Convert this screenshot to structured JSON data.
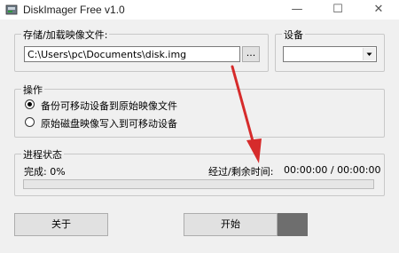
{
  "window": {
    "title": "DiskImager Free v1.0",
    "minimize_glyph": "—",
    "maximize_glyph": "☐",
    "close_glyph": "✕"
  },
  "storage": {
    "label": "存储/加载映像文件:",
    "path": "C:\\Users\\pc\\Documents\\disk.img",
    "browse_label": "..."
  },
  "device": {
    "label": "设备",
    "selected": ""
  },
  "operation": {
    "label": "操作",
    "options": [
      {
        "label": "备份可移动设备到原始映像文件",
        "checked": true
      },
      {
        "label": "原始磁盘映像写入到可移动设备",
        "checked": false
      }
    ]
  },
  "progress": {
    "label": "进程状态",
    "completed_label": "完成: 0%",
    "time_label": "经过/剩余时间:",
    "time_value": "00:00:00 / 00:00:00",
    "value": 0
  },
  "buttons": {
    "about": "关于",
    "start": "开始"
  },
  "colors": {
    "annotation_arrow": "#d62b2b",
    "start_disabled": "#6e6e6e"
  }
}
